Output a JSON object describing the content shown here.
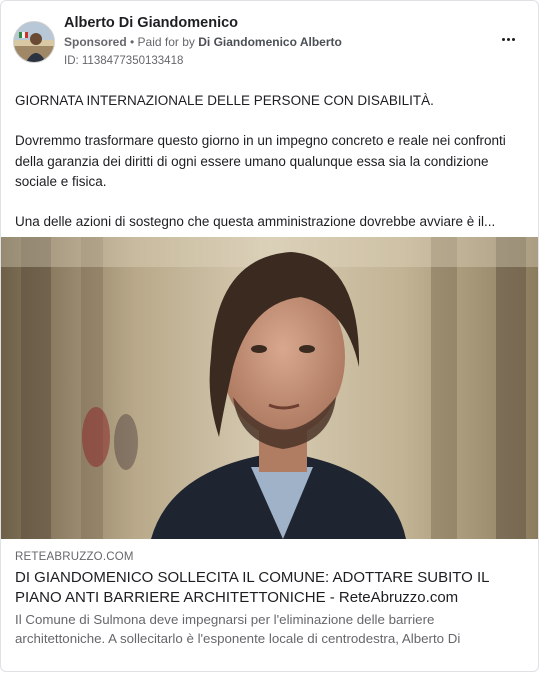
{
  "advertiser": {
    "name": "Alberto Di Giandomenico",
    "sponsored_label": "Sponsored",
    "separator": " • ",
    "paid_for_prefix": "Paid for by ",
    "payer": "Di Giandomenico Alberto",
    "ad_id": "ID: 1138477350133418"
  },
  "menu": {
    "icon": "more-horizontal-icon"
  },
  "body": {
    "paragraph_1": "GIORNATA INTERNAZIONALE DELLE PERSONE CON DISABILITÀ.",
    "paragraph_2": "Dovremmo trasformare questo giorno in un impegno concreto e reale nei confronti della garanzia dei diritti di ogni essere umano qualunque essa sia la condizione sociale e fisica.",
    "paragraph_3": "Una delle azioni di sostegno che questa amministrazione dovrebbe avviare è il..."
  },
  "link_preview": {
    "domain": "RETEABRUZZO.COM",
    "title": "DI GIANDOMENICO SOLLECITA IL COMUNE: ADOTTARE SUBITO IL PIANO ANTI BARRIERE ARCHITETTONICHE - ReteAbruzzo.com",
    "description": "Il Comune di Sulmona deve impegnarsi per l'eliminazione delle barriere architettoniche. A sollecitarlo è l'esponente locale di centrodestra, Alberto Di"
  },
  "colors": {
    "text_primary": "#1c1e21",
    "text_secondary": "#65676b",
    "border": "#dfe1e5"
  }
}
